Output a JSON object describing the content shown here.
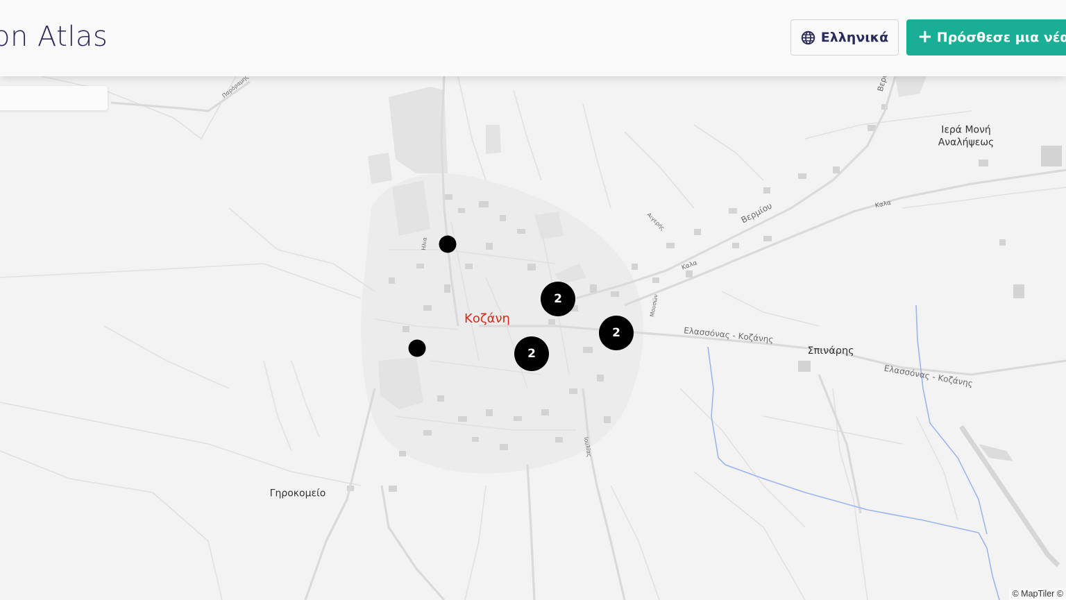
{
  "header": {
    "title": "on Atlas",
    "language_button": {
      "label": "Ελληνικά",
      "icon": "globe-icon"
    },
    "add_button": {
      "label": "Πρόσθεσε μια νέα τ",
      "icon": "plus-icon"
    }
  },
  "map": {
    "city": "Κοζάνη",
    "places": {
      "monastery": "Ιερά Μονή\nΑναλήψεως",
      "spinaris": "Σπινάρης",
      "girokomeio": "Γηροκομείο"
    },
    "roads": {
      "elassonas_1": "Ελασσόνας - Κοζάνης",
      "elassonas_2": "Ελασσόνας - Κοζάνης",
      "vermiou": "Βερμίου",
      "veroias": "Βερο",
      "kozani_road_1": "Καλα",
      "kozani_road_2": "Καλα",
      "paroramis": "Παρόραμης",
      "ilia": "Ηλια",
      "aigeris": "Αιγερής",
      "mousson": "Μουσών",
      "iouliou": "Ιουλίας"
    },
    "markers": [
      {
        "type": "single"
      },
      {
        "type": "single"
      },
      {
        "type": "cluster",
        "count": "2"
      },
      {
        "type": "cluster",
        "count": "2"
      },
      {
        "type": "cluster",
        "count": "2"
      }
    ],
    "attribution": "© MapTiler ©"
  },
  "colors": {
    "brand_text": "#2b2a5c",
    "accent": "#19ae96",
    "city_label": "#d42c1c",
    "marker": "#000000",
    "water": "#9bb5ef"
  }
}
